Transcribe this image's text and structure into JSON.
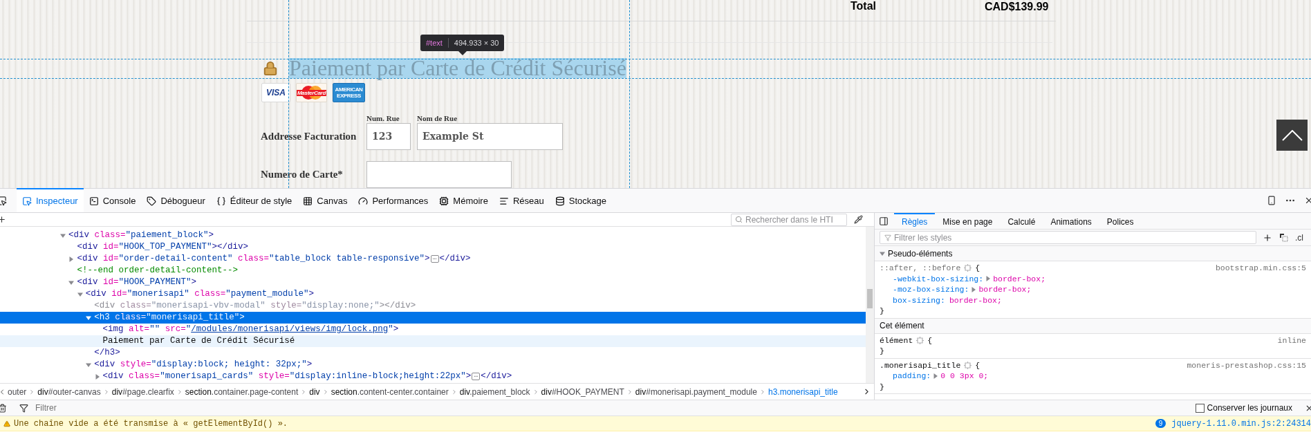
{
  "page": {
    "summary": {
      "label": "Total",
      "amount": "CAD$139.99"
    },
    "inspect_tooltip": {
      "node": "#text",
      "size": "494.933 × 30"
    },
    "payment": {
      "title": "Paiement par Carte de Crédit Sécurisé",
      "highlighted": true,
      "cards": [
        {
          "kind": "visa",
          "label": "VISA"
        },
        {
          "kind": "mastercard",
          "label": "MasterCard"
        },
        {
          "kind": "amex",
          "label": "AMERICAN EXPRESS"
        }
      ],
      "address": {
        "label": "Addresse Facturation",
        "fields": [
          {
            "caption": "Num. Rue",
            "value": "123"
          },
          {
            "caption": "Nom de Rue",
            "value": "Example St"
          }
        ]
      },
      "card_number": {
        "label": "Numero de Carte*"
      }
    }
  },
  "devtools": {
    "tabs": [
      {
        "kind": "inspector",
        "label": "Inspecteur",
        "selected": true
      },
      {
        "kind": "console",
        "label": "Console",
        "selected": false
      },
      {
        "kind": "debugger",
        "label": "Débogueur",
        "selected": false
      },
      {
        "kind": "style",
        "label": "Éditeur de style",
        "selected": false
      },
      {
        "kind": "canvas",
        "label": "Canvas",
        "selected": false
      },
      {
        "kind": "performance",
        "label": "Performances",
        "selected": false
      },
      {
        "kind": "memory",
        "label": "Mémoire",
        "selected": false
      },
      {
        "kind": "network",
        "label": "Réseau",
        "selected": false
      },
      {
        "kind": "storage",
        "label": "Stockage",
        "selected": false
      }
    ],
    "markup": {
      "search": {
        "placeholder": "Rechercher dans le HTI"
      },
      "nodes": [
        {
          "selected": false,
          "hovered": false,
          "dimmed": false,
          "expanded": true,
          "tokens": [
            {
              "kind": "tag",
              "text": "<div"
            },
            {
              "kind": "attr",
              "text": " class="
            },
            {
              "kind": "value",
              "text": "\"paiement_block\""
            },
            {
              "kind": "tag",
              "text": ">"
            }
          ],
          "children": [
            {
              "selected": false,
              "hovered": false,
              "dimmed": false,
              "tokens": [
                {
                  "kind": "tag",
                  "text": "<div"
                },
                {
                  "kind": "attr",
                  "text": " id="
                },
                {
                  "kind": "value",
                  "text": "\"HOOK_TOP_PAYMENT\""
                },
                {
                  "kind": "tag",
                  "text": "></div>"
                }
              ]
            },
            {
              "selected": false,
              "hovered": false,
              "dimmed": false,
              "expanded": false,
              "tokens": [
                {
                  "kind": "tag",
                  "text": "<div"
                },
                {
                  "kind": "attr",
                  "text": " id="
                },
                {
                  "kind": "value",
                  "text": "\"order-detail-content\""
                },
                {
                  "kind": "attr",
                  "text": " class="
                },
                {
                  "kind": "value",
                  "text": "\"table_block table-responsive\""
                },
                {
                  "kind": "tag",
                  "text": ">"
                },
                {
                  "kind": "ellipsis",
                  "text": "…"
                },
                {
                  "kind": "tag",
                  "text": "</div>"
                }
              ]
            },
            {
              "selected": false,
              "hovered": false,
              "dimmed": false,
              "tokens": [
                {
                  "kind": "comment",
                  "text": "<!--end order-detail-content-->"
                }
              ]
            },
            {
              "selected": false,
              "hovered": false,
              "dimmed": false,
              "expanded": true,
              "tokens": [
                {
                  "kind": "tag",
                  "text": "<div"
                },
                {
                  "kind": "attr",
                  "text": " id="
                },
                {
                  "kind": "value",
                  "text": "\"HOOK_PAYMENT\""
                },
                {
                  "kind": "tag",
                  "text": ">"
                }
              ],
              "children": [
                {
                  "selected": false,
                  "hovered": false,
                  "dimmed": false,
                  "expanded": true,
                  "tokens": [
                    {
                      "kind": "tag",
                      "text": "<div"
                    },
                    {
                      "kind": "attr",
                      "text": " id="
                    },
                    {
                      "kind": "value",
                      "text": "\"monerisapi\""
                    },
                    {
                      "kind": "attr",
                      "text": " class="
                    },
                    {
                      "kind": "value",
                      "text": "\"payment_module\""
                    },
                    {
                      "kind": "tag",
                      "text": ">"
                    }
                  ],
                  "children": [
                    {
                      "selected": false,
                      "hovered": false,
                      "dimmed": true,
                      "tokens": [
                        {
                          "kind": "tag",
                          "text": "<div"
                        },
                        {
                          "kind": "attr",
                          "text": " class="
                        },
                        {
                          "kind": "value",
                          "text": "\"monerisapi-vbv-modal\""
                        },
                        {
                          "kind": "attr",
                          "text": " style="
                        },
                        {
                          "kind": "value",
                          "text": "\"display:none;\""
                        },
                        {
                          "kind": "tag",
                          "text": "></div>"
                        }
                      ]
                    },
                    {
                      "selected": true,
                      "hovered": false,
                      "dimmed": false,
                      "expanded": true,
                      "tokens": [
                        {
                          "kind": "tag",
                          "text": "<h3"
                        },
                        {
                          "kind": "attr",
                          "text": " class="
                        },
                        {
                          "kind": "value",
                          "text": "\"monerisapi_title\""
                        },
                        {
                          "kind": "tag",
                          "text": ">"
                        }
                      ],
                      "children": [
                        {
                          "selected": false,
                          "hovered": false,
                          "dimmed": false,
                          "tokens": [
                            {
                              "kind": "tag",
                              "text": "<img"
                            },
                            {
                              "kind": "attr",
                              "text": " alt="
                            },
                            {
                              "kind": "value",
                              "text": "\"\""
                            },
                            {
                              "kind": "attr",
                              "text": " src="
                            },
                            {
                              "kind": "value",
                              "text": "\""
                            },
                            {
                              "kind": "link",
                              "text": "/modules/monerisapi/views/img/lock.png"
                            },
                            {
                              "kind": "value",
                              "text": "\""
                            },
                            {
                              "kind": "tag",
                              "text": ">"
                            }
                          ]
                        },
                        {
                          "selected": false,
                          "hovered": true,
                          "dimmed": false,
                          "tokens": [
                            {
                              "kind": "text",
                              "text": "Paiement par Carte de Crédit Sécurisé"
                            }
                          ]
                        }
                      ],
                      "closing": [
                        {
                          "kind": "tag",
                          "text": "</h3>"
                        }
                      ]
                    },
                    {
                      "selected": false,
                      "hovered": false,
                      "dimmed": false,
                      "expanded": true,
                      "tokens": [
                        {
                          "kind": "tag",
                          "text": "<div"
                        },
                        {
                          "kind": "attr",
                          "text": " style="
                        },
                        {
                          "kind": "value",
                          "text": "\"display:block; height: 32px;\""
                        },
                        {
                          "kind": "tag",
                          "text": ">"
                        }
                      ],
                      "children": [
                        {
                          "selected": false,
                          "hovered": false,
                          "dimmed": false,
                          "expanded": false,
                          "tokens": [
                            {
                              "kind": "tag",
                              "text": "<div"
                            },
                            {
                              "kind": "attr",
                              "text": " class="
                            },
                            {
                              "kind": "value",
                              "text": "\"monerisapi_cards\""
                            },
                            {
                              "kind": "attr",
                              "text": " style="
                            },
                            {
                              "kind": "value",
                              "text": "\"display:inline-block;height:22px\""
                            },
                            {
                              "kind": "tag",
                              "text": ">"
                            },
                            {
                              "kind": "ellipsis",
                              "text": "…"
                            },
                            {
                              "kind": "tag",
                              "text": "</div>"
                            }
                          ]
                        }
                      ]
                    }
                  ]
                }
              ]
            }
          ]
        }
      ]
    },
    "breadcrumbs": [
      {
        "rest": "outer",
        "selected": false
      },
      {
        "tag": "div",
        "rest": "#outer-canvas",
        "selected": false
      },
      {
        "tag": "div",
        "rest": "#page.clearfix",
        "selected": false
      },
      {
        "tag": "section",
        "rest": ".container.page-content",
        "selected": false
      },
      {
        "tag": "div",
        "selected": false
      },
      {
        "tag": "section",
        "rest": ".content-center.container",
        "selected": false
      },
      {
        "tag": "div",
        "rest": ".paiement_block",
        "selected": false
      },
      {
        "tag": "div",
        "rest": "#HOOK_PAYMENT",
        "selected": false
      },
      {
        "tag": "div",
        "rest": "#monerisapi.payment_module",
        "selected": false
      },
      {
        "tag": "h3",
        "rest": ".monerisapi_title",
        "selected": true
      }
    ],
    "sidebar": {
      "tabs": [
        {
          "label": "Règles",
          "selected": true
        },
        {
          "label": "Mise en page",
          "selected": false
        },
        {
          "label": "Calculé",
          "selected": false
        },
        {
          "label": "Animations",
          "selected": false
        },
        {
          "label": "Polices",
          "selected": false
        }
      ],
      "filter": {
        "placeholder": "Filtrer les styles"
      },
      "class_toggle": ".cl",
      "sections": [
        {
          "title": "Pseudo-éléments",
          "expanded": true,
          "rules": [
            {
              "selector": "::after, ::before",
              "pseudo": true,
              "open": "{",
              "source": "bootstrap.min.css:5",
              "close": "}",
              "declarations": [
                {
                  "property": "-webkit-box-sizing:",
                  "value": "border-box;",
                  "expandable": true
                },
                {
                  "property": "-moz-box-sizing:",
                  "value": "border-box;",
                  "expandable": true
                },
                {
                  "property": "box-sizing:",
                  "value": "border-box;",
                  "expandable": false
                }
              ]
            }
          ]
        },
        {
          "title": "Cet élément",
          "rules": [
            {
              "selector": "élément",
              "pseudo": false,
              "open": "{",
              "source": "inline",
              "close": "}"
            },
            {
              "selector": ".monerisapi_title",
              "pseudo": false,
              "open": "{",
              "source": "moneris-prestashop.css:15",
              "close": "}",
              "declarations": [
                {
                  "property": "padding:",
                  "value": "0 0 3px 0;",
                  "expandable": true
                }
              ]
            }
          ]
        }
      ]
    },
    "console": {
      "filter": {
        "placeholder": "Filtrer"
      },
      "persist_logs": {
        "label": "Conserver les journaux",
        "checked": false
      },
      "messages": [
        {
          "kind": "warning",
          "text": "Une chaîne vide a été transmise à « getElementById() ».",
          "count": "9",
          "source": "jquery-1.11.0.min.js:2:24314"
        }
      ]
    }
  }
}
